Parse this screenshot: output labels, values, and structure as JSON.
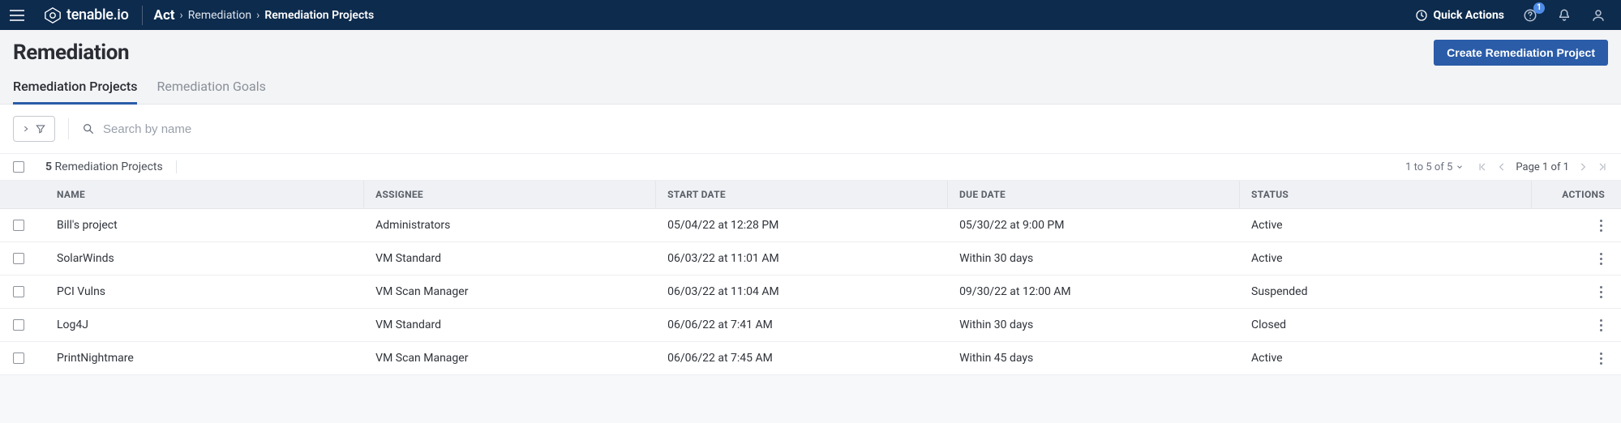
{
  "header": {
    "brand": "tenable.io",
    "breadcrumb": {
      "root": "Act",
      "mid": "Remediation",
      "leaf": "Remediation Projects"
    },
    "quick_actions": "Quick Actions",
    "help_badge": "1"
  },
  "page": {
    "title": "Remediation",
    "create_button": "Create Remediation Project"
  },
  "tabs": {
    "projects": "Remediation Projects",
    "goals": "Remediation Goals"
  },
  "search": {
    "placeholder": "Search by name"
  },
  "meta": {
    "count_bold": "5",
    "count_label": "Remediation Projects",
    "range": "1 to 5 of 5",
    "page_text": "Page 1 of 1"
  },
  "columns": {
    "name": "NAME",
    "assignee": "ASSIGNEE",
    "start": "START DATE",
    "due": "DUE DATE",
    "status": "STATUS",
    "actions": "ACTIONS"
  },
  "rows": [
    {
      "name": "Bill's project",
      "assignee": "Administrators",
      "start": "05/04/22 at 12:28 PM",
      "due": "05/30/22 at 9:00 PM",
      "status": "Active"
    },
    {
      "name": "SolarWinds",
      "assignee": "VM Standard",
      "start": "06/03/22 at 11:01 AM",
      "due": "Within 30 days",
      "status": "Active"
    },
    {
      "name": "PCI Vulns",
      "assignee": "VM Scan Manager",
      "start": "06/03/22 at 11:04 AM",
      "due": "09/30/22 at 12:00 AM",
      "status": "Suspended"
    },
    {
      "name": "Log4J",
      "assignee": "VM Standard",
      "start": "06/06/22 at 7:41 AM",
      "due": "Within 30 days",
      "status": "Closed"
    },
    {
      "name": "PrintNightmare",
      "assignee": "VM Scan Manager",
      "start": "06/06/22 at 7:45 AM",
      "due": "Within 45 days",
      "status": "Active"
    }
  ]
}
